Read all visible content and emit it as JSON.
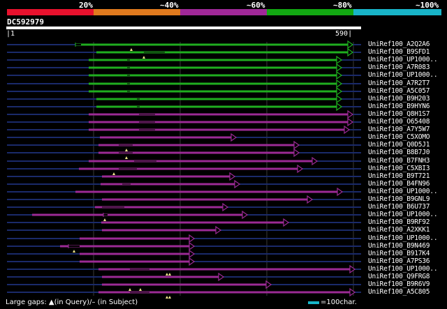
{
  "legend": {
    "labels": [
      "20%",
      "~40%",
      "~60%",
      "~80%",
      "~100%"
    ],
    "colors": [
      "#e8112d",
      "#e07a1e",
      "#a02898",
      "#12a812",
      "#18b4c8"
    ]
  },
  "query": {
    "title": "DC592979",
    "start": "1",
    "end": "590"
  },
  "hits": [
    {
      "name": "UniRef100_A2Q2A6",
      "start": 108,
      "end": 505,
      "color": "#1fae1f",
      "gaps": [
        [
          108,
          116,
          "wide"
        ]
      ],
      "marks": [
        188
      ]
    },
    {
      "name": "UniRef100_B9SFD1",
      "start": 138,
      "end": 505,
      "color": "#1fae1f",
      "gaps": [
        [
          206,
          236,
          "thin"
        ]
      ],
      "marks": [
        206
      ]
    },
    {
      "name": "UniRef100_UP1000..",
      "start": 127,
      "end": 489,
      "color": "#1fae1f",
      "gaps": [
        [
          182,
          186,
          "thin"
        ]
      ],
      "marks": []
    },
    {
      "name": "UniRef100_A7R083",
      "start": 127,
      "end": 489,
      "color": "#1fae1f",
      "gaps": [
        [
          182,
          186,
          "thin"
        ]
      ],
      "marks": []
    },
    {
      "name": "UniRef100_UP1000..",
      "start": 127,
      "end": 489,
      "color": "#1fae1f",
      "gaps": [
        [
          182,
          186,
          "thin"
        ]
      ],
      "marks": []
    },
    {
      "name": "UniRef100_A7R2T7",
      "start": 127,
      "end": 489,
      "color": "#1fae1f",
      "gaps": [
        [
          182,
          186,
          "thin"
        ]
      ],
      "marks": []
    },
    {
      "name": "UniRef100_A5C057",
      "start": 127,
      "end": 489,
      "color": "#1fae1f",
      "gaps": [
        [
          182,
          186,
          "thin"
        ]
      ],
      "marks": []
    },
    {
      "name": "UniRef100_B9H203",
      "start": 138,
      "end": 489,
      "color": "#1fae1f",
      "gaps": [
        [
          196,
          200,
          "thin"
        ]
      ],
      "marks": []
    },
    {
      "name": "UniRef100_B9HYN6",
      "start": 138,
      "end": 489,
      "color": "#1fae1f",
      "gaps": [
        [
          196,
          200,
          "thin"
        ]
      ],
      "marks": []
    },
    {
      "name": "UniRef100_Q8H1S7",
      "start": 127,
      "end": 505,
      "color": "#9b2a95",
      "gaps": [
        [
          199,
          222,
          "thin"
        ]
      ],
      "marks": []
    },
    {
      "name": "UniRef100_O65408",
      "start": 127,
      "end": 505,
      "color": "#9b2a95",
      "gaps": [
        [
          199,
          222,
          "thin"
        ]
      ],
      "marks": []
    },
    {
      "name": "UniRef100_A7Y5W7",
      "start": 127,
      "end": 500,
      "color": "#9b2a95",
      "gaps": [
        [
          199,
          222,
          "thin"
        ]
      ],
      "marks": []
    },
    {
      "name": "UniRef100_C5XOMO",
      "start": 143,
      "end": 338,
      "color": "#9b2a95",
      "gaps": [],
      "marks": []
    },
    {
      "name": "UniRef100_Q0D5J1",
      "start": 141,
      "end": 428,
      "color": "#9b2a95",
      "gaps": [
        [
          170,
          190,
          "thin"
        ]
      ],
      "marks": [
        181
      ]
    },
    {
      "name": "UniRef100_B8B7J0",
      "start": 141,
      "end": 428,
      "color": "#9b2a95",
      "gaps": [
        [
          170,
          190,
          "thin"
        ]
      ],
      "marks": [
        181
      ]
    },
    {
      "name": "UniRef100_B7FNH3",
      "start": 127,
      "end": 454,
      "color": "#9b2a95",
      "gaps": [
        [
          192,
          224,
          "thin"
        ]
      ],
      "marks": []
    },
    {
      "name": "UniRef100_C5XBI3",
      "start": 113,
      "end": 433,
      "color": "#9b2a95",
      "gaps": [
        [
          170,
          196,
          "thin"
        ]
      ],
      "marks": [
        163
      ]
    },
    {
      "name": "UniRef100_B9T721",
      "start": 146,
      "end": 336,
      "color": "#9b2a95",
      "gaps": [],
      "marks": []
    },
    {
      "name": "UniRef100_B4FN96",
      "start": 144,
      "end": 343,
      "color": "#9b2a95",
      "gaps": [
        [
          175,
          187,
          "thin"
        ]
      ],
      "marks": []
    },
    {
      "name": "UniRef100_UP1000..",
      "start": 108,
      "end": 490,
      "color": "#9b2a95",
      "gaps": [],
      "marks": []
    },
    {
      "name": "UniRef100_B9GNL9",
      "start": 146,
      "end": 447,
      "color": "#9b2a95",
      "gaps": [],
      "marks": []
    },
    {
      "name": "UniRef100_B6U737",
      "start": 136,
      "end": 326,
      "color": "#9b2a95",
      "gaps": [
        [
          146,
          178,
          "thin"
        ]
      ],
      "marks": []
    },
    {
      "name": "UniRef100_UP1000..",
      "start": 46,
      "end": 354,
      "color": "#9b2a95",
      "gaps": [
        [
          148,
          154,
          "wide"
        ]
      ],
      "marks": [
        150
      ]
    },
    {
      "name": "UniRef100_B9RF92",
      "start": 145,
      "end": 413,
      "color": "#9b2a95",
      "gaps": [],
      "marks": []
    },
    {
      "name": "UniRef100_A2XKK1",
      "start": 146,
      "end": 316,
      "color": "#9b2a95",
      "gaps": [],
      "marks": []
    },
    {
      "name": "UniRef100_UP1000..",
      "start": 114,
      "end": 278,
      "color": "#9b2a95",
      "gaps": [],
      "marks": []
    },
    {
      "name": "UniRef100_B9N469",
      "start": 86,
      "end": 278,
      "color": "#9b2a95",
      "gaps": [
        [
          98,
          114,
          "wide"
        ]
      ],
      "marks": [
        106
      ]
    },
    {
      "name": "UniRef100_B917K4",
      "start": 114,
      "end": 278,
      "color": "#9b2a95",
      "gaps": [],
      "marks": []
    },
    {
      "name": "UniRef100_A7PS36",
      "start": 114,
      "end": 278,
      "color": "#9b2a95",
      "gaps": [],
      "marks": []
    },
    {
      "name": "UniRef100_UP1000..",
      "start": 141,
      "end": 508,
      "color": "#9b2a95",
      "gaps": [
        [
          186,
          214,
          "thin"
        ]
      ],
      "marks": [
        239,
        243
      ]
    },
    {
      "name": "UniRef100_Q9FRG8",
      "start": 146,
      "end": 320,
      "color": "#9b2a95",
      "gaps": [],
      "marks": []
    },
    {
      "name": "UniRef100_B9R6V9",
      "start": 146,
      "end": 388,
      "color": "#9b2a95",
      "gaps": [],
      "marks": [
        186,
        201
      ]
    },
    {
      "name": "UniRef100_A5C805",
      "start": 141,
      "end": 508,
      "color": "#9b2a95",
      "gaps": [
        [
          186,
          214,
          "thin"
        ]
      ],
      "marks": [
        239,
        243
      ]
    }
  ],
  "footer": {
    "text": "Large gaps: ▲(in Query)/– (in Subject)",
    "unit": "=100char."
  }
}
